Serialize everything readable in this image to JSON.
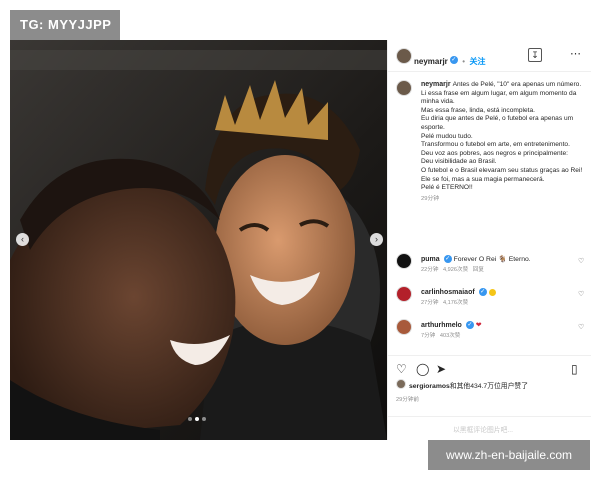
{
  "tag": {
    "label": "TG: MYYJJPP"
  },
  "header": {
    "username": "neymarjr",
    "follow_label": "关注"
  },
  "caption": {
    "username": "neymarjr",
    "lines": [
      "Antes de Pelé, \"10\" era apenas um número.",
      "Li essa frase em algum lugar, em algum momento da minha vida.",
      "Mas essa frase, linda, está incompleta.",
      "Eu diria que antes de Pelé, o futebol era apenas um esporte.",
      "Pelé mudou tudo.",
      "Transformou o futebol em arte, em entretenimento.",
      "Deu voz aos pobres, aos negros e principalmente:",
      "Deu visibilidade ao Brasil.",
      "O futebol e o Brasil elevaram seu status graças ao Rei!",
      "Ele se foi, mas a sua magia permanecerá.",
      "Pelé é ETERNO!!"
    ],
    "time": "29分钟"
  },
  "comments": [
    {
      "username": "puma",
      "text": "Forever O Rei",
      "trail": "Eterno.",
      "time": "22分钟",
      "likes": "4,926次赞",
      "reply": "回复"
    },
    {
      "username": "carlinhosmaiaof",
      "text": "",
      "trail": "",
      "time": "27分钟",
      "likes": "4,176次赞",
      "reply": ""
    },
    {
      "username": "arthurhmelo",
      "text": "",
      "trail": "",
      "time": "7分钟",
      "likes": "403次赞",
      "reply": ""
    }
  ],
  "likes": {
    "username": "sergioramos",
    "text": "和其他434.7万位用户赞了"
  },
  "post_time": "29分钟前",
  "comment_placeholder": "以黑框评论图片吧...",
  "watermark": {
    "label": "www.zh-en-baijaile.com"
  },
  "icons": {
    "save": "save-icon",
    "more": "more-icon",
    "like": "heart-icon",
    "comment": "comment-icon",
    "share": "share-icon",
    "bookmark": "bookmark-icon"
  },
  "carousel": {
    "total": 3,
    "active": 2
  },
  "colors": {
    "accent": "#0095f6",
    "verified": "#3897f0",
    "watermark_bg": "#8c8c8c"
  }
}
